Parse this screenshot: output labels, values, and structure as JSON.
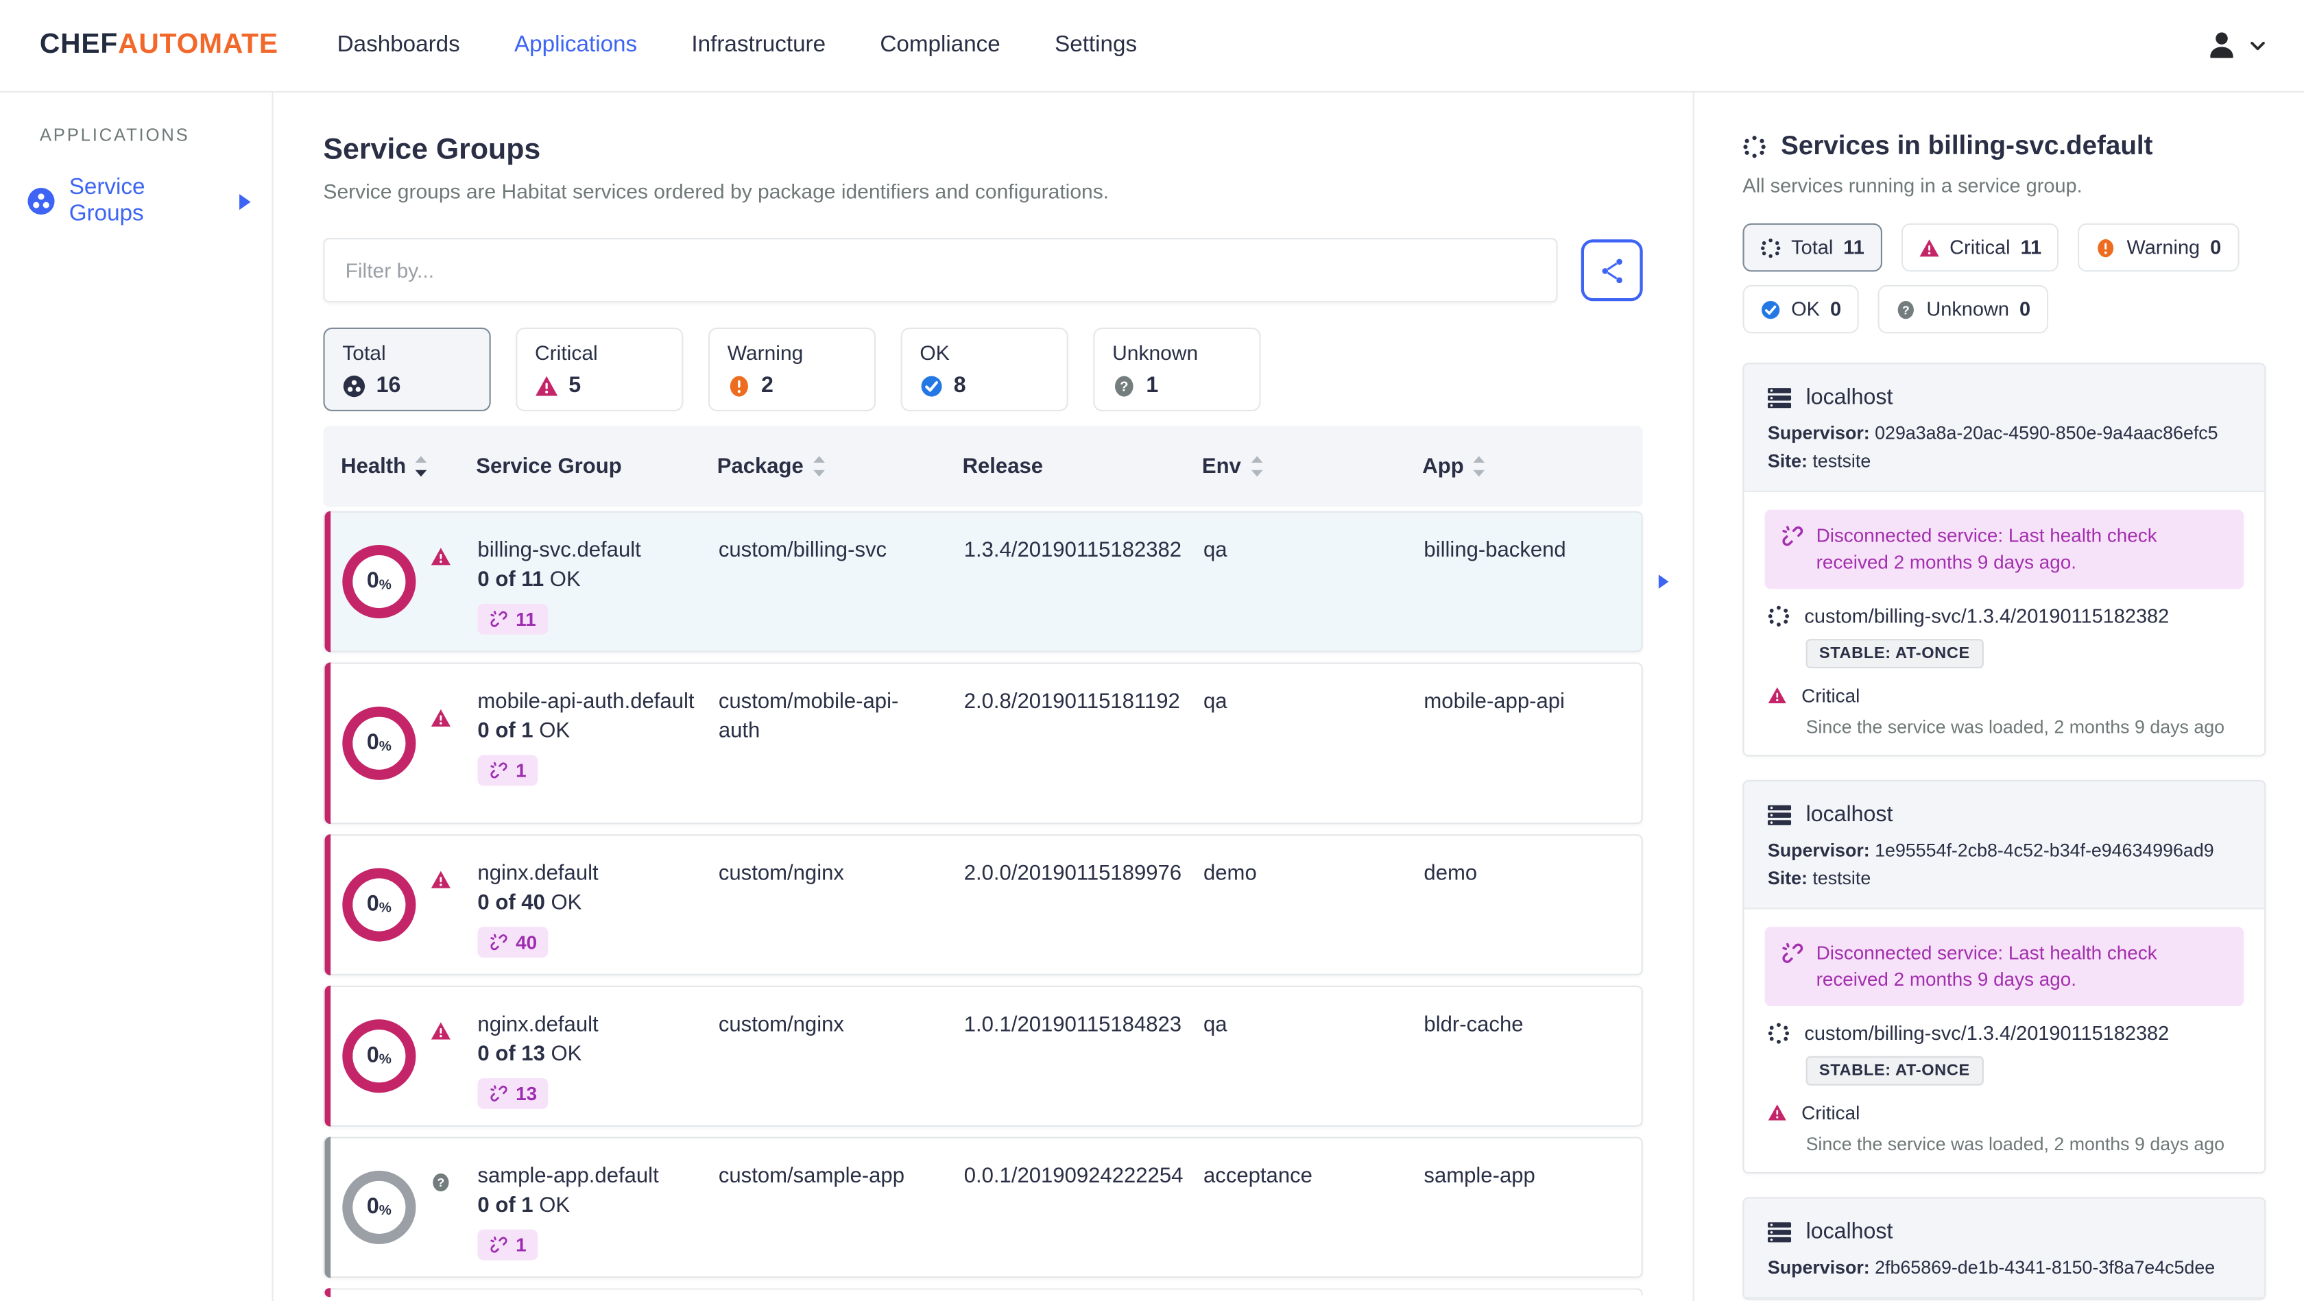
{
  "brand": {
    "chef": "CHEF",
    "automate": "AUTOMATE"
  },
  "nav": {
    "items": [
      {
        "label": "Dashboards",
        "active": false
      },
      {
        "label": "Applications",
        "active": true
      },
      {
        "label": "Infrastructure",
        "active": false
      },
      {
        "label": "Compliance",
        "active": false
      },
      {
        "label": "Settings",
        "active": false
      }
    ]
  },
  "sidebar": {
    "section": "APPLICATIONS",
    "items": [
      {
        "label": "Service Groups",
        "icon": "service-groups"
      }
    ]
  },
  "main": {
    "title": "Service Groups",
    "subtitle": "Service groups are Habitat services ordered by package identifiers and configurations.",
    "filter_placeholder": "Filter by...",
    "summary_cards": [
      {
        "label": "Total",
        "value": "16",
        "icon": "total",
        "selected": true
      },
      {
        "label": "Critical",
        "value": "5",
        "icon": "critical",
        "selected": false
      },
      {
        "label": "Warning",
        "value": "2",
        "icon": "warning",
        "selected": false
      },
      {
        "label": "OK",
        "value": "8",
        "icon": "ok",
        "selected": false
      },
      {
        "label": "Unknown",
        "value": "1",
        "icon": "unknown",
        "selected": false
      }
    ],
    "table": {
      "columns": [
        {
          "label": "Health",
          "sort": "desc"
        },
        {
          "label": "Service Group",
          "sort": null
        },
        {
          "label": "Package",
          "sort": "none"
        },
        {
          "label": "Release",
          "sort": null
        },
        {
          "label": "Env",
          "sort": "none"
        },
        {
          "label": "App",
          "sort": "none"
        }
      ],
      "rows": [
        {
          "selected": true,
          "tall": false,
          "status": "critical",
          "health": "0",
          "percent": "%",
          "group": "billing-svc.default",
          "ok": "0 of 11",
          "ok_suffix": "OK",
          "disconnected": "11",
          "package": "custom/billing-svc",
          "release": "1.3.4/20190115182382",
          "env": "qa",
          "app": "billing-backend"
        },
        {
          "selected": false,
          "tall": true,
          "status": "critical",
          "health": "0",
          "percent": "%",
          "group": "mobile-api-auth.default",
          "ok": "0 of 1",
          "ok_suffix": "OK",
          "disconnected": "1",
          "package": "custom/mobile-api-auth",
          "release": "2.0.8/20190115181192",
          "env": "qa",
          "app": "mobile-app-api"
        },
        {
          "selected": false,
          "tall": false,
          "status": "critical",
          "health": "0",
          "percent": "%",
          "group": "nginx.default",
          "ok": "0 of 40",
          "ok_suffix": "OK",
          "disconnected": "40",
          "package": "custom/nginx",
          "release": "2.0.0/20190115189976",
          "env": "demo",
          "app": "demo"
        },
        {
          "selected": false,
          "tall": false,
          "status": "critical",
          "health": "0",
          "percent": "%",
          "group": "nginx.default",
          "ok": "0 of 13",
          "ok_suffix": "OK",
          "disconnected": "13",
          "package": "custom/nginx",
          "release": "1.0.1/20190115184823",
          "env": "qa",
          "app": "bldr-cache"
        },
        {
          "selected": false,
          "tall": false,
          "status": "unknown",
          "health": "0",
          "percent": "%",
          "group": "sample-app.default",
          "ok": "0 of 1",
          "ok_suffix": "OK",
          "disconnected": "1",
          "package": "custom/sample-app",
          "release": "0.0.1/20190924222254",
          "env": "acceptance",
          "app": "sample-app"
        }
      ],
      "has_clipped_row": true
    }
  },
  "panel": {
    "title": "Services in billing-svc.default",
    "subtitle": "All services running in a service group.",
    "pill_rows": [
      [
        {
          "label": "Total",
          "value": "11",
          "icon": "total-dots",
          "selected": true
        },
        {
          "label": "Critical",
          "value": "11",
          "icon": "critical",
          "selected": false
        },
        {
          "label": "Warning",
          "value": "0",
          "icon": "warning",
          "selected": false
        }
      ],
      [
        {
          "label": "OK",
          "value": "0",
          "icon": "ok",
          "selected": false
        },
        {
          "label": "Unknown",
          "value": "0",
          "icon": "unknown",
          "selected": false
        }
      ]
    ],
    "services": [
      {
        "host": "localhost",
        "supervisor_label": "Supervisor:",
        "supervisor": "029a3a8a-20ac-4590-850e-9a4aac86efc5",
        "site_label": "Site:",
        "site": "testsite",
        "alert": "Disconnected service: Last health check received 2 months 9 days ago.",
        "package": "custom/billing-svc/1.3.4/20190115182382",
        "channel": "STABLE: AT-ONCE",
        "status": "Critical",
        "since": "Since the service was loaded, 2 months 9 days ago"
      },
      {
        "host": "localhost",
        "supervisor_label": "Supervisor:",
        "supervisor": "1e95554f-2cb8-4c52-b34f-e94634996ad9",
        "site_label": "Site:",
        "site": "testsite",
        "alert": "Disconnected service: Last health check received 2 months 9 days ago.",
        "package": "custom/billing-svc/1.3.4/20190115182382",
        "channel": "STABLE: AT-ONCE",
        "status": "Critical",
        "since": "Since the service was loaded, 2 months 9 days ago"
      },
      {
        "host": "localhost",
        "supervisor_label": "Supervisor:",
        "supervisor": "2fb65869-de1b-4341-8150-3f8a7e4c5dee"
      }
    ]
  },
  "colors": {
    "primary_blue": "#3d64f4",
    "brand_orange": "#f2682a",
    "critical": "#c42568",
    "warning": "#ed6c1f",
    "ok": "#2478e4",
    "unknown": "#747d7d",
    "disconnected_text": "#9d2db0",
    "disconnected_bg": "#f7e3f9",
    "navy": "#2a2f45"
  }
}
